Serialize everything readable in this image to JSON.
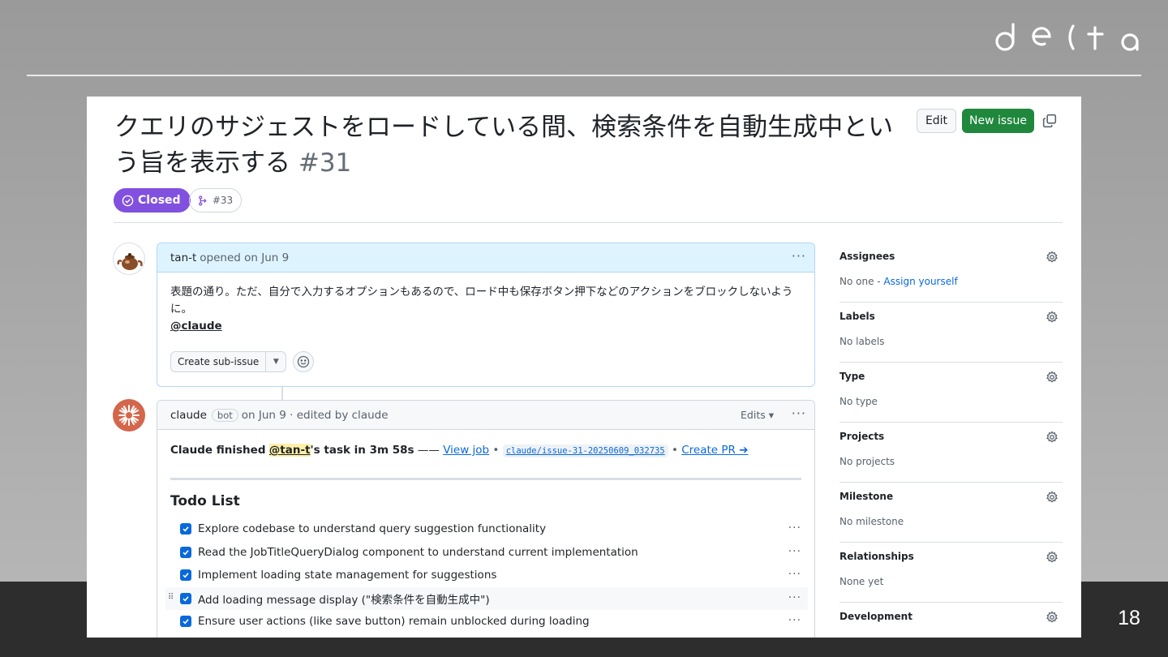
{
  "slide": {
    "logo_text": "delta",
    "page_number": "18"
  },
  "issue": {
    "title": "クエリのサジェストをロードしている間、検索条件を自動生成中という旨を表示する",
    "number": "#31",
    "state": "Closed",
    "linked_pr": "#33",
    "actions": {
      "edit": "Edit",
      "new_issue": "New issue"
    }
  },
  "comments": [
    {
      "author": "tan-t",
      "meta": "opened on Jun 9",
      "body": "表題の通り。ただ、自分で入力するオプションもあるので、ロード中も保存ボタン押下などのアクションをブロックしないように。",
      "mention": "@claude",
      "sub_issue_label": "Create sub-issue"
    },
    {
      "author": "claude",
      "badge": "bot",
      "meta": "on Jun 9 · edited by claude",
      "edits_label": "Edits",
      "status_prefix": "Claude finished",
      "status_mention": "@tan-t",
      "status_suffix": "'s task in 3m 58s",
      "status_dash": "——",
      "view_job": "View job",
      "branch": "claude/issue-31-20250609_032735",
      "create_pr": "Create PR ➔",
      "todo_title": "Todo List",
      "todos": [
        "Explore codebase to understand query suggestion functionality",
        "Read the JobTitleQueryDialog component to understand current implementation",
        "Implement loading state management for suggestions",
        "Add loading message display (\"検索条件を自動生成中\")",
        "Ensure user actions (like save button) remain unblocked during loading"
      ]
    }
  ],
  "sidebar": [
    {
      "heading": "Assignees",
      "value": "No one - ",
      "link": "Assign yourself"
    },
    {
      "heading": "Labels",
      "value": "No labels"
    },
    {
      "heading": "Type",
      "value": "No type"
    },
    {
      "heading": "Projects",
      "value": "No projects"
    },
    {
      "heading": "Milestone",
      "value": "No milestone"
    },
    {
      "heading": "Relationships",
      "value": "None yet"
    },
    {
      "heading": "Development",
      "value": ""
    }
  ],
  "colors": {
    "closed_purple": "#8250df",
    "new_issue_green": "#1f883d",
    "link_blue": "#0969da"
  }
}
